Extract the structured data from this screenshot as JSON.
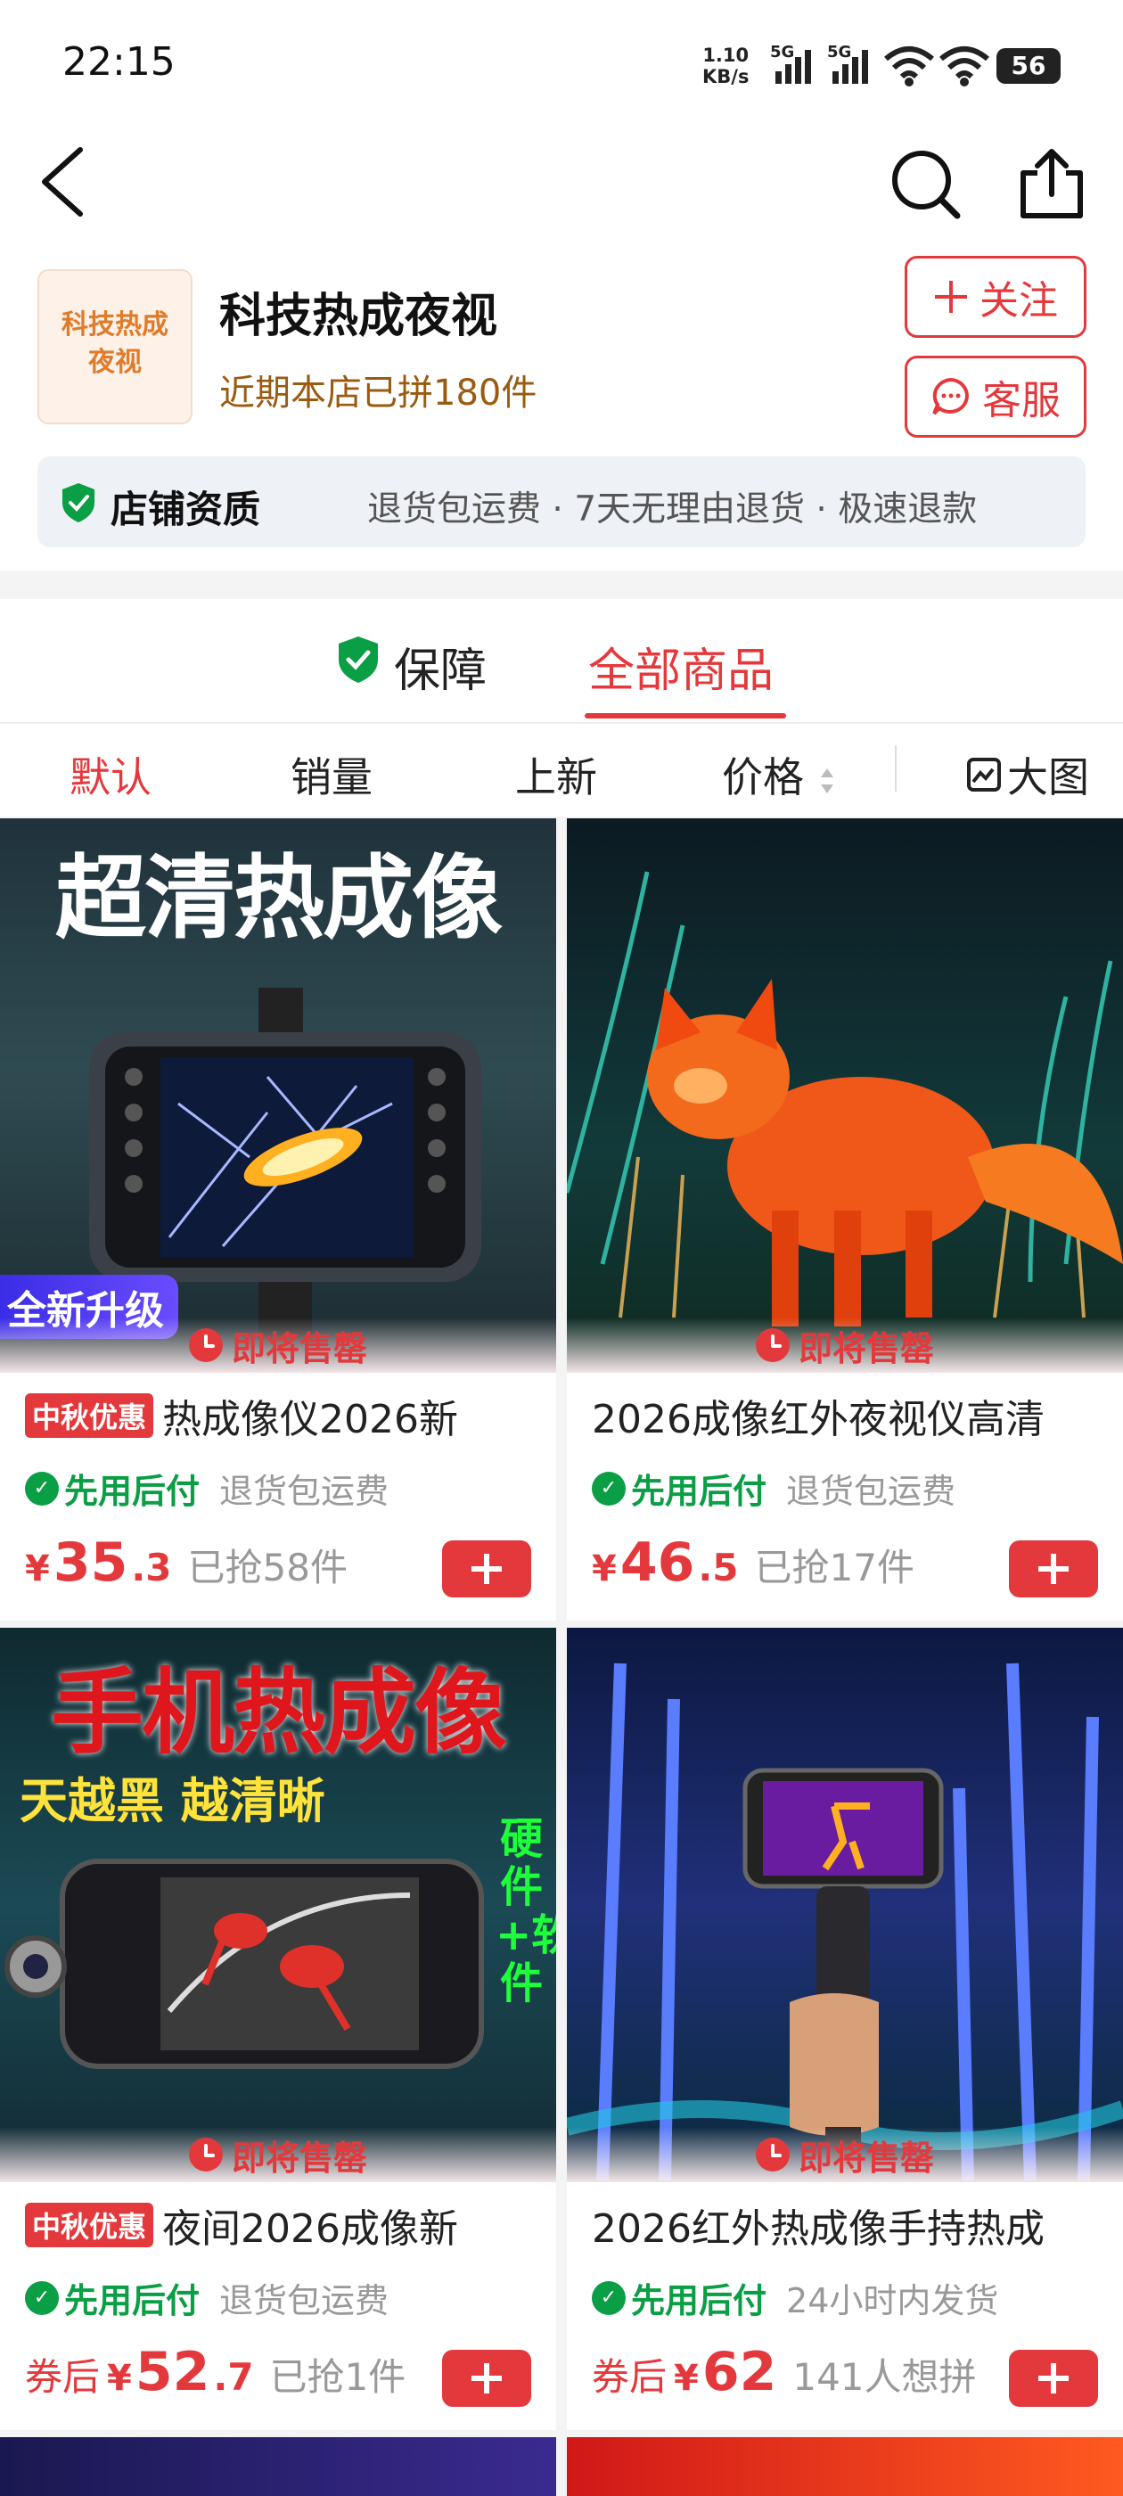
{
  "status_bar": {
    "time": "22:15",
    "net_speed_value": "1.10",
    "net_speed_unit": "KB/s",
    "sim1": "5G",
    "sim2": "5G",
    "battery": "56"
  },
  "nav": {
    "back_icon": "chevron-left-icon",
    "search_icon": "search-icon",
    "share_icon": "share-icon"
  },
  "shop": {
    "logo_line1": "科技热成",
    "logo_line2": "夜视",
    "name": "科技热成夜视",
    "recent_sales": "近期本店已拼180件",
    "follow_label": "关注",
    "service_label": "客服"
  },
  "qualification": {
    "title": "店铺资质",
    "desc": "退货包运费 · 7天无理由退货 · 极速退款"
  },
  "tabs": [
    {
      "label": "保障",
      "active": false
    },
    {
      "label": "全部商品",
      "active": true
    }
  ],
  "sort": {
    "default": "默认",
    "sales": "销量",
    "new": "上新",
    "price": "价格",
    "big_view": "大图"
  },
  "colors": {
    "accent": "#e4393c",
    "green": "#0a9e45",
    "brown": "#9a5a10"
  },
  "products": [
    {
      "image_text": "超清热成像",
      "image_badge": "全新升级",
      "soon_label": "即将售罄",
      "promo_tag": "中秋优惠",
      "title": "热成像仪2026新",
      "pay_later": "先用后付",
      "service_tag": "退货包运费",
      "coupon_prefix": "",
      "price_int": "35",
      "price_dec": ".3",
      "sold": "已抢58件"
    },
    {
      "soon_label": "即将售罄",
      "title": "2026成像红外夜视仪高清",
      "pay_later": "先用后付",
      "service_tag": "退货包运费",
      "coupon_prefix": "",
      "price_int": "46",
      "price_dec": ".5",
      "sold": "已抢17件"
    },
    {
      "image_text": "手机热成像",
      "image_sub": "天越黑 越清晰",
      "image_side": "硬件+软件",
      "soon_label": "即将售罄",
      "promo_tag": "中秋优惠",
      "title": "夜间2026成像新",
      "pay_later": "先用后付",
      "service_tag": "退货包运费",
      "coupon_prefix": "券后",
      "price_int": "52",
      "price_dec": ".7",
      "sold": "已抢1件"
    },
    {
      "soon_label": "即将售罄",
      "title": "2026红外热成像手持热成",
      "pay_later": "先用后付",
      "service_tag": "24小时内发货",
      "coupon_prefix": "券后",
      "price_int": "62",
      "price_dec": "",
      "sold": "141人想拼"
    }
  ]
}
